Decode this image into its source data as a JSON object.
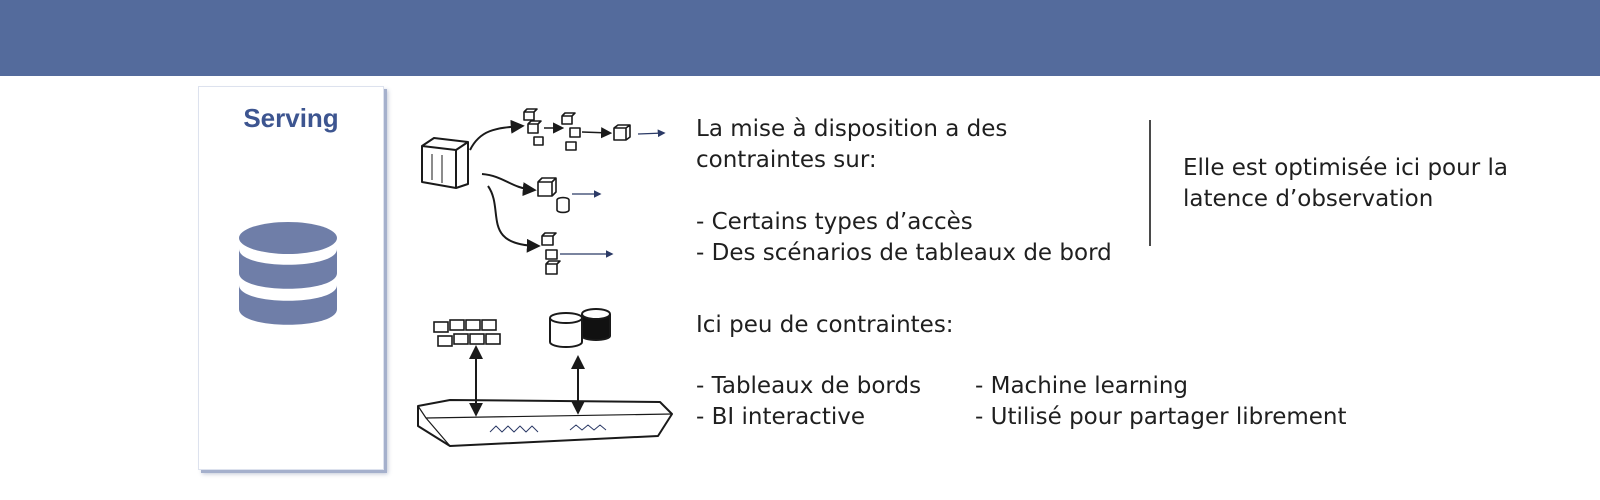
{
  "header": {
    "bar_color": "#546b9c"
  },
  "serving_card": {
    "title": "Serving",
    "icon": "database-icon",
    "title_color": "#3d5590",
    "icon_color": "#6f7ea8"
  },
  "sketches": {
    "top": "pipeline-sketch-icon",
    "bottom": "storage-sketch-icon"
  },
  "serving_constraints": {
    "intro_line1": "La mise à disposition a des",
    "intro_line2": "contraintes sur:",
    "items": [
      "- Certains types d’accès",
      "- Des scénarios de tableaux de bord"
    ]
  },
  "optimization_note": {
    "line1": "Elle est optimisée ici pour la",
    "line2": "latence d’observation"
  },
  "low_constraints": {
    "intro": "Ici peu de contraintes:",
    "left_items": [
      "- Tableaux de bords",
      "- BI interactive"
    ],
    "right_items": [
      "- Machine learning",
      "- Utilisé pour partager librement"
    ]
  }
}
